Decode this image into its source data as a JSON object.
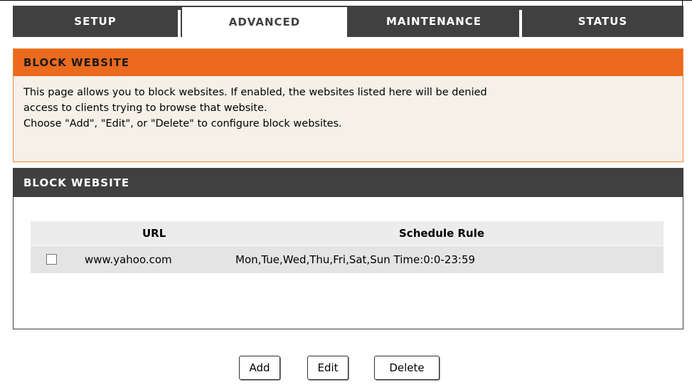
{
  "tabs": [
    {
      "label": "SETUP",
      "active": false
    },
    {
      "label": "ADVANCED",
      "active": true
    },
    {
      "label": "MAINTENANCE",
      "active": false
    },
    {
      "label": "STATUS",
      "active": false
    }
  ],
  "info_panel": {
    "title": "BLOCK WEBSITE",
    "lines": [
      "This page allows you to block websites. If enabled, the websites listed here will be denied",
      "access to clients trying to browse that website.",
      "Choose \"Add\", \"Edit\", or \"Delete\" to configure block websites."
    ]
  },
  "list_panel": {
    "title": "BLOCK WEBSITE",
    "columns": {
      "url": "URL",
      "schedule": "Schedule Rule"
    },
    "rows": [
      {
        "checked": false,
        "url": "www.yahoo.com",
        "schedule": "Mon,Tue,Wed,Thu,Fri,Sat,Sun Time:0:0-23:59"
      }
    ]
  },
  "buttons": {
    "add": "Add",
    "edit": "Edit",
    "delete": "Delete"
  },
  "colors": {
    "tab_bar": "#404040",
    "orange_header": "#ec6a1e",
    "orange_border": "#f08838",
    "dark_header": "#404040"
  }
}
